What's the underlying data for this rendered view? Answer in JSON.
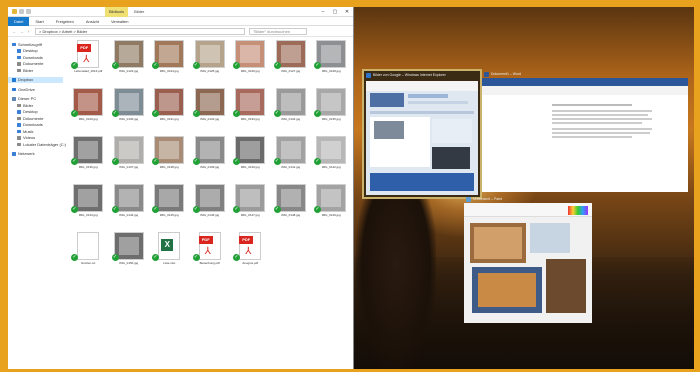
{
  "explorer": {
    "context_tab": "Bildtools",
    "window_title": "Bilder",
    "window_controls": [
      "–",
      "▢",
      "✕"
    ],
    "ribbon_tabs": [
      "Datei",
      "Start",
      "Freigeben",
      "Ansicht",
      "Verwalten"
    ],
    "nav_buttons": [
      "←",
      "→",
      "↑"
    ],
    "address": "> Dropbox > Arbeit > Bilder",
    "search_placeholder": "\"Bilder\" durchsuchen",
    "nav_items": [
      {
        "label": "Schnellzugriff",
        "icon": "star-icon",
        "color": "#3b7fd6",
        "indent": false,
        "gap": false,
        "selected": false
      },
      {
        "label": "Desktop",
        "icon": "desktop-icon",
        "color": "#3b7fd6",
        "indent": true,
        "gap": false,
        "selected": false
      },
      {
        "label": "Downloads",
        "icon": "download-icon",
        "color": "#3b7fd6",
        "indent": true,
        "gap": false,
        "selected": false
      },
      {
        "label": "Dokumente",
        "icon": "documents-icon",
        "color": "#8a8a8a",
        "indent": true,
        "gap": false,
        "selected": false
      },
      {
        "label": "Bilder",
        "icon": "pictures-icon",
        "color": "#8a8a8a",
        "indent": true,
        "gap": false,
        "selected": false
      },
      {
        "label": "Dropbox",
        "icon": "dropbox-icon",
        "color": "#1f78d1",
        "indent": false,
        "gap": true,
        "selected": true
      },
      {
        "label": "OneDrive",
        "icon": "onedrive-icon",
        "color": "#2d7ad6",
        "indent": false,
        "gap": true,
        "selected": false
      },
      {
        "label": "Dieser PC",
        "icon": "computer-icon",
        "color": "#5c87b4",
        "indent": false,
        "gap": true,
        "selected": false
      },
      {
        "label": "Bilder",
        "icon": "pictures-icon",
        "color": "#8a8a8a",
        "indent": true,
        "gap": false,
        "selected": false
      },
      {
        "label": "Desktop",
        "icon": "desktop-icon",
        "color": "#3b7fd6",
        "indent": true,
        "gap": false,
        "selected": false
      },
      {
        "label": "Dokumente",
        "icon": "documents-icon",
        "color": "#8a8a8a",
        "indent": true,
        "gap": false,
        "selected": false
      },
      {
        "label": "Downloads",
        "icon": "download-icon",
        "color": "#3b7fd6",
        "indent": true,
        "gap": false,
        "selected": false
      },
      {
        "label": "Musik",
        "icon": "music-icon",
        "color": "#3b7fd6",
        "indent": true,
        "gap": false,
        "selected": false
      },
      {
        "label": "Videos",
        "icon": "video-icon",
        "color": "#8a8a8a",
        "indent": true,
        "gap": false,
        "selected": false
      },
      {
        "label": "Lokaler Datenträger (C:)",
        "icon": "drive-icon",
        "color": "#8a8a8a",
        "indent": true,
        "gap": false,
        "selected": false
      },
      {
        "label": "Netzwerk",
        "icon": "network-icon",
        "color": "#3b7fd6",
        "indent": false,
        "gap": true,
        "selected": false
      }
    ],
    "files": [
      {
        "kind": "pdf",
        "name": "Lebenslauf_2016.pdf",
        "color": "#ffffff"
      },
      {
        "kind": "image",
        "name": "IMG_0123.jpg",
        "color": "#8f7b64"
      },
      {
        "kind": "image",
        "name": "IMG_0124.jpg",
        "color": "#a2785a"
      },
      {
        "kind": "image",
        "name": "IMG_0125.jpg",
        "color": "#b5a48b"
      },
      {
        "kind": "image",
        "name": "IMG_0126.jpg",
        "color": "#c58f78"
      },
      {
        "kind": "image",
        "name": "IMG_0127.jpg",
        "color": "#9c6c58"
      },
      {
        "kind": "image",
        "name": "IMG_0128.jpg",
        "color": "#8d8f92"
      },
      {
        "kind": "image",
        "name": "IMG_0129.jpg",
        "color": "#a45a48"
      },
      {
        "kind": "image",
        "name": "IMG_0130.jpg",
        "color": "#7e8c96"
      },
      {
        "kind": "image",
        "name": "IMG_0131.jpg",
        "color": "#9a5f4f"
      },
      {
        "kind": "image",
        "name": "IMG_0132.jpg",
        "color": "#8c6852"
      },
      {
        "kind": "image",
        "name": "IMG_0133.jpg",
        "color": "#a86a5c"
      },
      {
        "kind": "image",
        "name": "IMG_0134.jpg",
        "color": "#9a9a9a"
      },
      {
        "kind": "image",
        "name": "IMG_0135.jpg",
        "color": "#a8a8a8"
      },
      {
        "kind": "image",
        "name": "IMG_0136.jpg",
        "color": "#6f6f6f"
      },
      {
        "kind": "image",
        "name": "IMG_0137.jpg",
        "color": "#b0aeaa"
      },
      {
        "kind": "image",
        "name": "IMG_0138.jpg",
        "color": "#a88c76"
      },
      {
        "kind": "image",
        "name": "IMG_0139.jpg",
        "color": "#8a8a8a"
      },
      {
        "kind": "image",
        "name": "IMG_0140.jpg",
        "color": "#6b6b6b"
      },
      {
        "kind": "image",
        "name": "IMG_0141.jpg",
        "color": "#a2a2a2"
      },
      {
        "kind": "image",
        "name": "IMG_0142.jpg",
        "color": "#b7b7b7"
      },
      {
        "kind": "image",
        "name": "IMG_0143.jpg",
        "color": "#6f6f6f"
      },
      {
        "kind": "image",
        "name": "IMG_0144.jpg",
        "color": "#8a8a8a"
      },
      {
        "kind": "image",
        "name": "IMG_0145.jpg",
        "color": "#7a7a7a"
      },
      {
        "kind": "image",
        "name": "IMG_0146.jpg",
        "color": "#808080"
      },
      {
        "kind": "image",
        "name": "IMG_0147.jpg",
        "color": "#9b9b9b"
      },
      {
        "kind": "image",
        "name": "IMG_0148.jpg",
        "color": "#888888"
      },
      {
        "kind": "image",
        "name": "IMG_0149.jpg",
        "color": "#a3a3a3"
      },
      {
        "kind": "blank",
        "name": "Notizen.txt",
        "color": "#ffffff"
      },
      {
        "kind": "image",
        "name": "IMG_0150.jpg",
        "color": "#6d6d6d"
      },
      {
        "kind": "xls",
        "name": "Liste.xlsx",
        "color": "#ffffff"
      },
      {
        "kind": "pdf",
        "name": "Bewerbung.pdf",
        "color": "#ffffff"
      },
      {
        "kind": "pdf",
        "name": "Zeugnis.pdf",
        "color": "#ffffff"
      }
    ]
  },
  "task_view": {
    "browser": {
      "title": "Bilder von Google – Windows Internet Explorer",
      "icon_color": "#2f74c8"
    },
    "word": {
      "title": "Dokument1 – Word",
      "icon_color": "#2b579a"
    },
    "paint": {
      "title": "Unbenannt – Paint",
      "icon_color": "#5a9fd6"
    }
  }
}
